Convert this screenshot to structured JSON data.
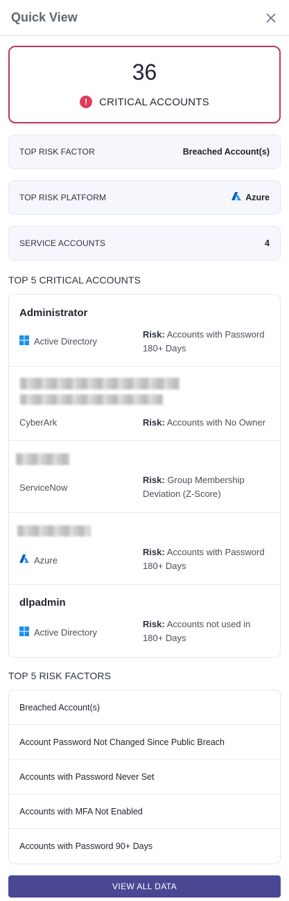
{
  "header": {
    "title": "Quick View"
  },
  "critical": {
    "count": "36",
    "label": "CRITICAL ACCOUNTS",
    "color": "#c0385a"
  },
  "summary": [
    {
      "label": "TOP RISK FACTOR",
      "value": "Breached Account(s)",
      "icon": ""
    },
    {
      "label": "TOP RISK PLATFORM",
      "value": "Azure",
      "icon": "azure-logo-icon"
    },
    {
      "label": "SERVICE ACCOUNTS",
      "value": "4",
      "icon": ""
    }
  ],
  "top_accounts": {
    "title": "TOP 5 CRITICAL ACCOUNTS",
    "risk_prefix": "Risk:",
    "items": [
      {
        "name": "Administrator",
        "platform": "Active Directory",
        "platform_icon": "windows-icon",
        "risk": "Accounts with Password 180+ Days"
      },
      {
        "name": "",
        "platform": "CyberArk",
        "platform_icon": "",
        "risk": "Accounts with No Owner"
      },
      {
        "name": "",
        "platform": "ServiceNow",
        "platform_icon": "",
        "risk": "Group Membership Deviation (Z-Score)"
      },
      {
        "name": "",
        "platform": "Azure",
        "platform_icon": "azure-logo-icon",
        "risk": "Accounts with Password 180+ Days"
      },
      {
        "name": "dlpadmin",
        "platform": "Active Directory",
        "platform_icon": "windows-icon",
        "risk": "Accounts not used in 180+ Days"
      }
    ]
  },
  "risk_factors": {
    "title": "TOP 5 RISK FACTORS",
    "items": [
      "Breached Account(s)",
      "Account Password Not Changed Since Public Breach",
      "Accounts with Password Never Set",
      "Accounts with MFA Not Enabled",
      "Accounts with Password 90+ Days"
    ]
  },
  "button": {
    "label": "VIEW ALL DATA",
    "color": "#4b4893"
  }
}
